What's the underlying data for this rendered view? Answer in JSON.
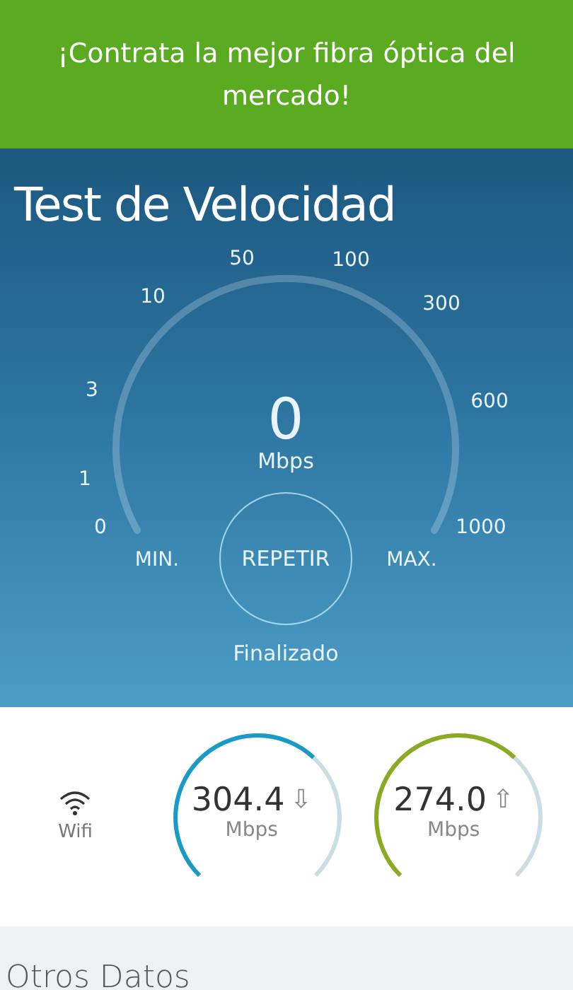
{
  "banner": {
    "text": "¡Contrata la mejor fibra óptica del mercado!"
  },
  "speed_test": {
    "title": "Test de Velocidad",
    "scale": [
      "0",
      "1",
      "3",
      "10",
      "50",
      "100",
      "300",
      "600",
      "1000"
    ],
    "reading": "0",
    "unit": "Mbps",
    "min_label": "MIN.",
    "max_label": "MAX.",
    "button": "REPETIR",
    "status": "Finalizado"
  },
  "results": {
    "connection": {
      "label": "Wifi"
    },
    "gauges": [
      {
        "value": "304.4",
        "arrow": "⇩",
        "unit": "Mbps",
        "color": "#1a9bc7"
      },
      {
        "value": "274.0",
        "arrow": "⇧",
        "unit": "Mbps",
        "color": "#8aab1f"
      }
    ]
  },
  "other_data": {
    "title": "Otros Datos"
  }
}
